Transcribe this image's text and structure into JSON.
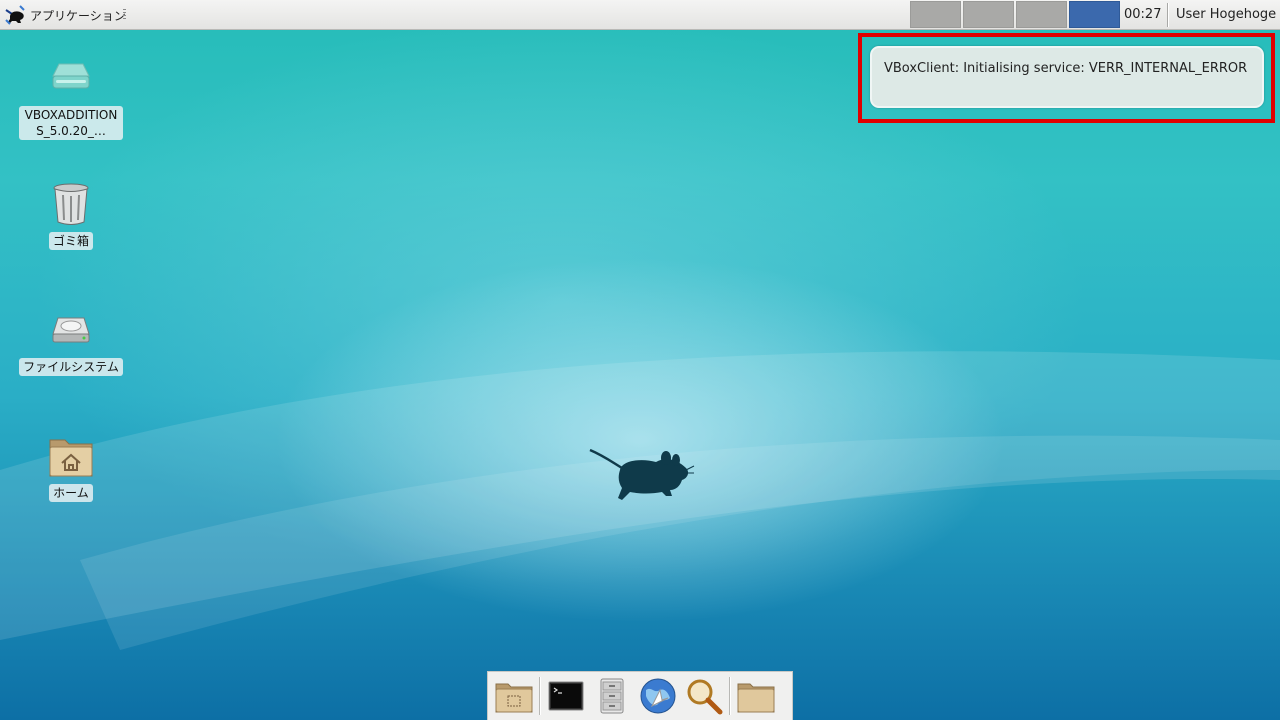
{
  "panel": {
    "app_menu_label": "アプリケーション",
    "workspaces": [
      {
        "active": false
      },
      {
        "active": false
      },
      {
        "active": false
      },
      {
        "active": true
      }
    ],
    "clock": "00:27",
    "user": "User Hogehoge"
  },
  "desktop_icons": [
    {
      "label": "VBOXADDITIONS_5.0.20_…",
      "icon": "optical-disc-icon"
    },
    {
      "label": "ゴミ箱",
      "icon": "trash-icon"
    },
    {
      "label": "ファイルシステム",
      "icon": "hard-drive-icon"
    },
    {
      "label": "ホーム",
      "icon": "home-folder-icon"
    }
  ],
  "notification": {
    "message": "VBoxClient: Initialising service: VERR_INTERNAL_ERROR"
  },
  "dock": {
    "items": [
      {
        "icon": "show-desktop-icon"
      },
      {
        "icon": "terminal-icon"
      },
      {
        "icon": "file-manager-icon"
      },
      {
        "icon": "web-browser-icon"
      },
      {
        "icon": "app-finder-icon"
      },
      {
        "icon": "folder-icon"
      }
    ]
  },
  "colors": {
    "workspace_active": "#3b69ad",
    "workspace_inactive": "#a9a9a7",
    "highlight": "#e00000"
  }
}
